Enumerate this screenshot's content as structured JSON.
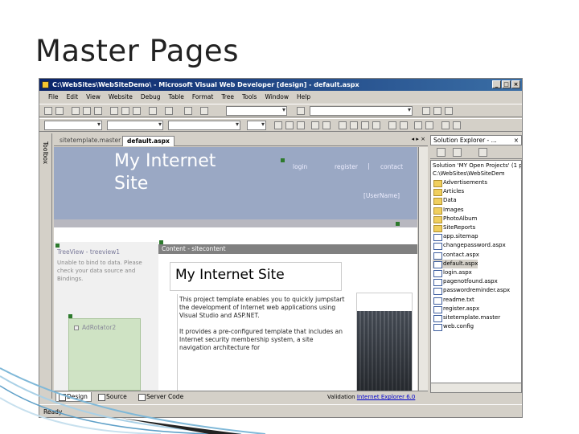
{
  "slide": {
    "title": "Master Pages"
  },
  "window": {
    "title": "C:\\WebSites\\WebSiteDemo\\ - Microsoft Visual Web Developer [design] - default.aspx",
    "buttons": [
      "_",
      "□",
      "×"
    ]
  },
  "menu": [
    "File",
    "Edit",
    "View",
    "Website",
    "Debug",
    "Table",
    "Format",
    "Tree",
    "Tools",
    "Window",
    "Help"
  ],
  "toolbox": {
    "label": "Toolbox"
  },
  "doc_tabs": {
    "inactive": "sitetemplate.master",
    "active": "default.aspx",
    "controls": "◂ ▸ ×"
  },
  "site": {
    "title": "My Internet Site",
    "links": [
      "login",
      "register",
      "contact"
    ],
    "separators": [
      "|",
      "|"
    ],
    "user_name": "[UserName]"
  },
  "tree": {
    "label": "TreeView - treeview1",
    "message": "Unable to bind to data. Please check your data source and Bindings."
  },
  "ad": {
    "label": "AdRotator2"
  },
  "content": {
    "header": "Content - sitecontent",
    "title": "My Internet Site",
    "para1": "This project template enables you to quickly jumpstart the development of Internet web applications using Visual Studio and ASP.NET.",
    "para2": "It provides a pre-configured template that includes an Internet security membership system, a site navigation architecture for"
  },
  "bottom_tabs": [
    "Design",
    "Source",
    "Server Code"
  ],
  "validation": {
    "label": "Validation",
    "target": "Internet Explorer 6.0"
  },
  "status": "Ready",
  "solution": {
    "title": "Solution Explorer - ...",
    "close": "×",
    "root": "Solution 'MY Open Projects' (1 pr",
    "project": "C:\\WebSites\\WebSiteDem",
    "items": [
      {
        "name": "Advertisements",
        "kind": "folder"
      },
      {
        "name": "Articles",
        "kind": "folder"
      },
      {
        "name": "Data",
        "kind": "folder"
      },
      {
        "name": "Images",
        "kind": "folder"
      },
      {
        "name": "PhotoAlbum",
        "kind": "folder"
      },
      {
        "name": "SiteReports",
        "kind": "folder"
      },
      {
        "name": "app.sitemap",
        "kind": "file"
      },
      {
        "name": "changepassword.aspx",
        "kind": "file"
      },
      {
        "name": "contact.aspx",
        "kind": "file"
      },
      {
        "name": "default.aspx",
        "kind": "file",
        "selected": true
      },
      {
        "name": "login.aspx",
        "kind": "file"
      },
      {
        "name": "pagenotfound.aspx",
        "kind": "file"
      },
      {
        "name": "passwordreminder.aspx",
        "kind": "file"
      },
      {
        "name": "readme.txt",
        "kind": "file"
      },
      {
        "name": "register.aspx",
        "kind": "file"
      },
      {
        "name": "sitetemplate.master",
        "kind": "file"
      },
      {
        "name": "web.config",
        "kind": "file"
      }
    ]
  },
  "colors": {
    "titlebar": "#0a246a",
    "header_band": "#9aa8c4",
    "ad_box": "#cfe3c4",
    "chrome": "#d4d0c8"
  }
}
